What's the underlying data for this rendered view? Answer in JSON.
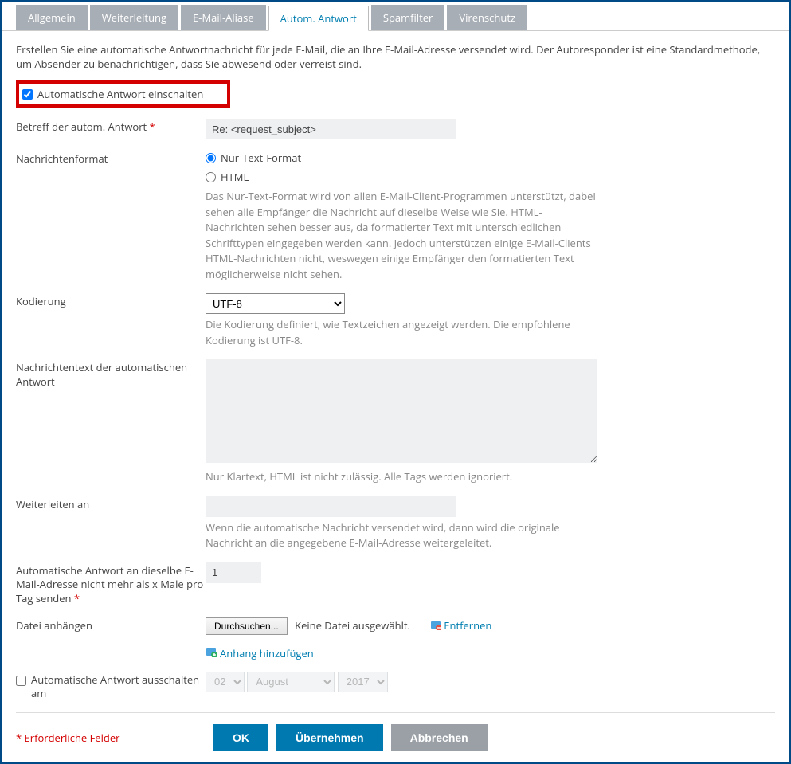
{
  "tabs": {
    "general": "Allgemein",
    "forward": "Weiterleitung",
    "aliases": "E-Mail-Aliase",
    "autoreply": "Autom. Antwort",
    "spam": "Spamfilter",
    "virus": "Virenschutz"
  },
  "intro": "Erstellen Sie eine automatische Antwortnachricht für jede E-Mail, die an Ihre E-Mail-Adresse versendet wird. Der Autoresponder ist eine Standardmethode, um Absender zu benachrichtigen, dass Sie abwesend oder verreist sind.",
  "enable_label": "Automatische Antwort einschalten",
  "fields": {
    "subject_label": "Betreff der autom. Antwort",
    "subject_value": "Re: <request_subject>",
    "format_label": "Nachrichtenformat",
    "format_plain": "Nur-Text-Format",
    "format_html": "HTML",
    "format_note": "Das Nur-Text-Format wird von allen E-Mail-Client-Programmen unterstützt, dabei sehen alle Empfänger die Nachricht auf dieselbe Weise wie Sie. HTML-Nachrichten sehen besser aus, da formatierter Text mit unterschiedlichen Schrifttypen eingegeben werden kann. Jedoch unterstützen einige E-Mail-Clients HTML-Nachrichten nicht, weswegen einige Empfänger den formatierten Text möglicherweise nicht sehen.",
    "encoding_label": "Kodierung",
    "encoding_value": "UTF-8",
    "encoding_note": "Die Kodierung definiert, wie Textzeichen angezeigt werden. Die empfohlene Kodierung ist UTF-8.",
    "msgtext_label": "Nachrichtentext der automatischen Antwort",
    "msgtext_note": "Nur Klartext, HTML ist nicht zulässig. Alle Tags werden ignoriert.",
    "forwardto_label": "Weiterleiten an",
    "forwardto_note": "Wenn die automatische Nachricht versendet wird, dann wird die originale Nachricht an die angegebene E-Mail-Adresse weitergeleitet.",
    "limit_label": "Automatische Antwort an dieselbe E-Mail-Adresse nicht mehr als x Male pro Tag senden",
    "limit_value": "1",
    "attach_label": "Datei anhängen",
    "browse_label": "Durchsuchen...",
    "no_file_label": "Keine Datei ausgewählt.",
    "remove_label": "Entfernen",
    "add_attach_label": "Anhang hinzufügen",
    "disable_label": "Automatische Antwort ausschalten am",
    "date_day": "02",
    "date_month": "August",
    "date_year": "2017"
  },
  "footer": {
    "required_note": "* Erforderliche Felder",
    "ok": "OK",
    "apply": "Übernehmen",
    "cancel": "Abbrechen"
  }
}
